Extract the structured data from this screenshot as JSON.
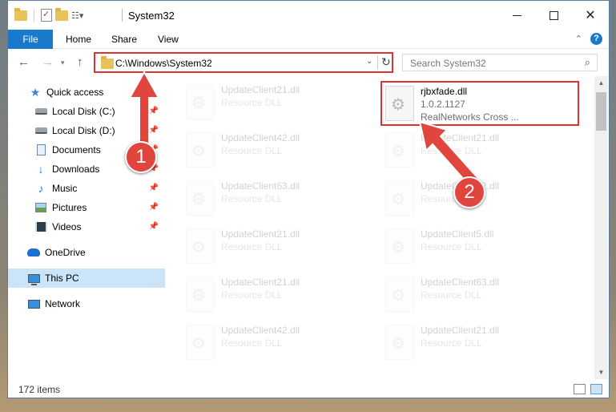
{
  "window": {
    "title": "System32"
  },
  "ribbon": {
    "tabs": [
      "File",
      "Home",
      "Share",
      "View"
    ]
  },
  "nav": {
    "address": "C:\\Windows\\System32",
    "search_placeholder": "Search System32"
  },
  "sidebar": {
    "items": [
      {
        "label": "Quick access",
        "icon": "star-icon",
        "pinned": false
      },
      {
        "label": "Local Disk (C:)",
        "icon": "drive-icon",
        "pinned": true
      },
      {
        "label": "Local Disk (D:)",
        "icon": "drive-icon",
        "pinned": true
      },
      {
        "label": "Documents",
        "icon": "documents-icon",
        "pinned": true
      },
      {
        "label": "Downloads",
        "icon": "download-icon",
        "pinned": true
      },
      {
        "label": "Music",
        "icon": "music-icon",
        "pinned": true
      },
      {
        "label": "Pictures",
        "icon": "pictures-icon",
        "pinned": true
      },
      {
        "label": "Videos",
        "icon": "videos-icon",
        "pinned": true
      },
      {
        "label": "OneDrive",
        "icon": "cloud-icon",
        "pinned": false
      },
      {
        "label": "This PC",
        "icon": "computer-icon",
        "pinned": false,
        "selected": true
      },
      {
        "label": "Network",
        "icon": "network-icon",
        "pinned": false
      }
    ]
  },
  "files": {
    "left_column": [
      {
        "name": "UpdateClient21.dll",
        "type": "Resource DLL"
      },
      {
        "name": "UpdateClient42.dll",
        "type": "Resource DLL"
      },
      {
        "name": "UpdateClient63.dll",
        "type": "Resource DLL"
      },
      {
        "name": "UpdateClient21.dll",
        "type": "Resource DLL"
      },
      {
        "name": "UpdateClient21.dll",
        "type": "Resource DLL"
      },
      {
        "name": "UpdateClient42.dll",
        "type": "Resource DLL"
      }
    ],
    "right_column": [
      {
        "name": "rjbxfade.dll",
        "version": "1.0.2.1127",
        "company": "RealNetworks Cross ...",
        "highlighted": true
      },
      {
        "name": "UpdateClient21.dll",
        "type": "Resource DLL"
      },
      {
        "name": "UpdateClient42.dll",
        "type": "Resource DLL"
      },
      {
        "name": "UpdateClient5.dll",
        "type": "Resource DLL"
      },
      {
        "name": "UpdateClient63.dll",
        "type": "Resource DLL"
      },
      {
        "name": "UpdateClient21.dll",
        "type": "Resource DLL"
      }
    ]
  },
  "status": {
    "item_count": "172 items"
  },
  "annotations": {
    "step1": "1",
    "step2": "2",
    "color": "#e0453e"
  }
}
